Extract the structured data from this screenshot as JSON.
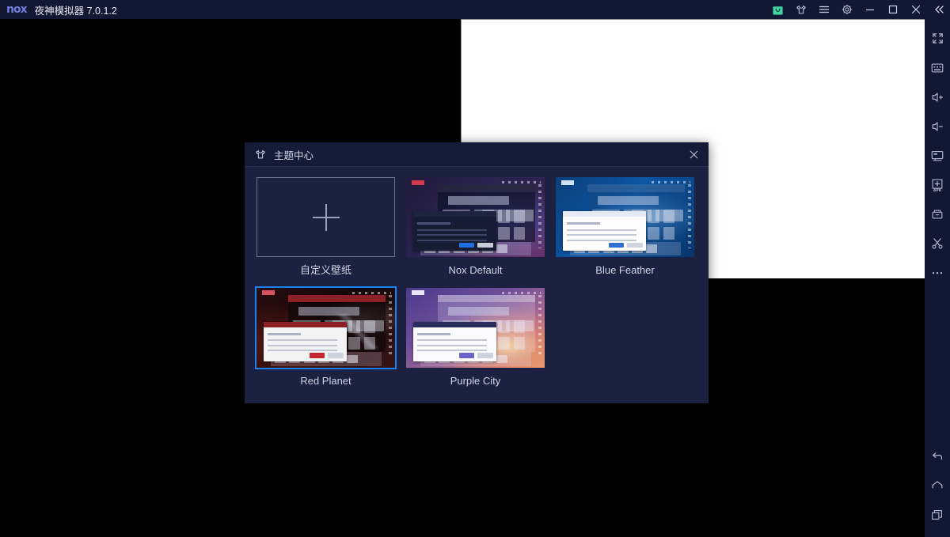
{
  "titlebar": {
    "logo": "nox",
    "title": "夜神模拟器 7.0.1.2",
    "buttons": [
      {
        "name": "store-icon",
        "label": "应用商店"
      },
      {
        "name": "tshirt-icon",
        "label": "主题中心"
      },
      {
        "name": "menu-icon",
        "label": "菜单"
      },
      {
        "name": "gear-icon",
        "label": "设置"
      },
      {
        "name": "minimize-icon",
        "label": "最小化"
      },
      {
        "name": "maximize-icon",
        "label": "最大化"
      },
      {
        "name": "close-icon",
        "label": "关闭"
      },
      {
        "name": "collapse-icon",
        "label": "收起"
      }
    ]
  },
  "toolbar": {
    "items": [
      {
        "name": "fullscreen-icon",
        "label": "全屏"
      },
      {
        "name": "keyboard-icon",
        "label": "键盘控制"
      },
      {
        "name": "volume-up-icon",
        "label": "音量+"
      },
      {
        "name": "volume-down-icon",
        "label": "音量-"
      },
      {
        "name": "screen-icon",
        "label": "屏幕"
      },
      {
        "name": "apk-install-icon",
        "label": "安装APK"
      },
      {
        "name": "file-manager-icon",
        "label": "共享文件夹"
      },
      {
        "name": "scissors-icon",
        "label": "截图"
      },
      {
        "name": "more-icon",
        "label": "更多"
      }
    ],
    "nav": [
      {
        "name": "back-icon",
        "label": "返回"
      },
      {
        "name": "home-icon",
        "label": "主页"
      },
      {
        "name": "recents-icon",
        "label": "多任务"
      }
    ]
  },
  "dialog": {
    "title": "主题中心",
    "close_label": "×",
    "themes": [
      {
        "name": "custom-wallpaper",
        "label": "自定义壁纸",
        "selected": false,
        "kind": "custom"
      },
      {
        "name": "nox-default",
        "label": "Nox Default",
        "selected": false,
        "kind": "nox"
      },
      {
        "name": "blue-feather",
        "label": "Blue Feather",
        "selected": false,
        "kind": "blue"
      },
      {
        "name": "red-planet",
        "label": "Red Planet",
        "selected": true,
        "kind": "red"
      },
      {
        "name": "purple-city",
        "label": "Purple City",
        "selected": false,
        "kind": "purple"
      }
    ]
  },
  "colors": {
    "titlebar_bg": "#121733",
    "dialog_bg": "#1c2142",
    "dialog_header_bg": "#151a36",
    "selection_border": "#1a82f0",
    "store_icon_green": "#3dd6a0",
    "text_primary": "#ced3e4",
    "screen_bg": "#000000",
    "white_panel": "#ffffff"
  }
}
